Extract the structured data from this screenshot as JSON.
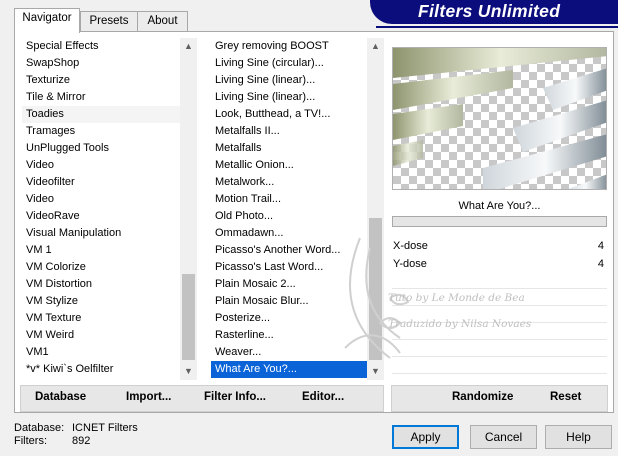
{
  "tabs": [
    {
      "label": "Navigator",
      "active": true
    },
    {
      "label": "Presets",
      "active": false
    },
    {
      "label": "About",
      "active": false
    }
  ],
  "banner": {
    "title": "Filters Unlimited",
    "color": "#0c0d7d"
  },
  "categories": {
    "items": [
      {
        "label": "Special Effects"
      },
      {
        "label": "SwapShop"
      },
      {
        "label": "Texturize"
      },
      {
        "label": "Tile & Mirror"
      },
      {
        "label": "Toadies",
        "highlighted": true
      },
      {
        "label": "Tramages"
      },
      {
        "label": "UnPlugged Tools"
      },
      {
        "label": "Video"
      },
      {
        "label": "Videofilter"
      },
      {
        "label": "Video"
      },
      {
        "label": "VideoRave"
      },
      {
        "label": "Visual Manipulation"
      },
      {
        "label": "VM 1"
      },
      {
        "label": "VM Colorize"
      },
      {
        "label": "VM Distortion"
      },
      {
        "label": "VM Stylize"
      },
      {
        "label": "VM Texture"
      },
      {
        "label": "VM Weird"
      },
      {
        "label": "VM1"
      },
      {
        "label": "*v* Kiwi`s Oelfilter"
      }
    ]
  },
  "filters": {
    "items": [
      {
        "label": "Grey removing BOOST"
      },
      {
        "label": "Living Sine (circular)..."
      },
      {
        "label": "Living Sine (linear)..."
      },
      {
        "label": "Living Sine (linear)..."
      },
      {
        "label": "Look, Butthead, a TV!..."
      },
      {
        "label": "Metalfalls II..."
      },
      {
        "label": "Metalfalls"
      },
      {
        "label": "Metallic Onion..."
      },
      {
        "label": "Metalwork..."
      },
      {
        "label": "Motion Trail..."
      },
      {
        "label": "Old Photo..."
      },
      {
        "label": "Ommadawn..."
      },
      {
        "label": "Picasso's Another Word..."
      },
      {
        "label": "Picasso's Last Word..."
      },
      {
        "label": "Plain Mosaic 2..."
      },
      {
        "label": "Plain Mosaic Blur..."
      },
      {
        "label": "Posterize..."
      },
      {
        "label": "Rasterline..."
      },
      {
        "label": "Weaver..."
      },
      {
        "label": "What Are You?...",
        "selected": true
      }
    ]
  },
  "preview": {
    "filter_name": "What Are You?..."
  },
  "params": [
    {
      "label": "X-dose",
      "value": "4"
    },
    {
      "label": "Y-dose",
      "value": "4"
    }
  ],
  "watermark": {
    "line1": "Tuto by Le Monde de Bea",
    "line2": "Traduzido by Nilsa Novaes"
  },
  "toolbar_left": {
    "database": "Database",
    "import": "Import...",
    "filter_info": "Filter Info...",
    "editor": "Editor..."
  },
  "toolbar_right": {
    "randomize": "Randomize",
    "reset": "Reset"
  },
  "info": {
    "database_label": "Database:",
    "database_value": "ICNET Filters",
    "filters_label": "Filters:",
    "filters_value": "892"
  },
  "buttons": {
    "apply": "Apply",
    "cancel": "Cancel",
    "help": "Help"
  },
  "colors": {
    "selection": "#0a64d8",
    "banner": "#0c0d7d"
  }
}
